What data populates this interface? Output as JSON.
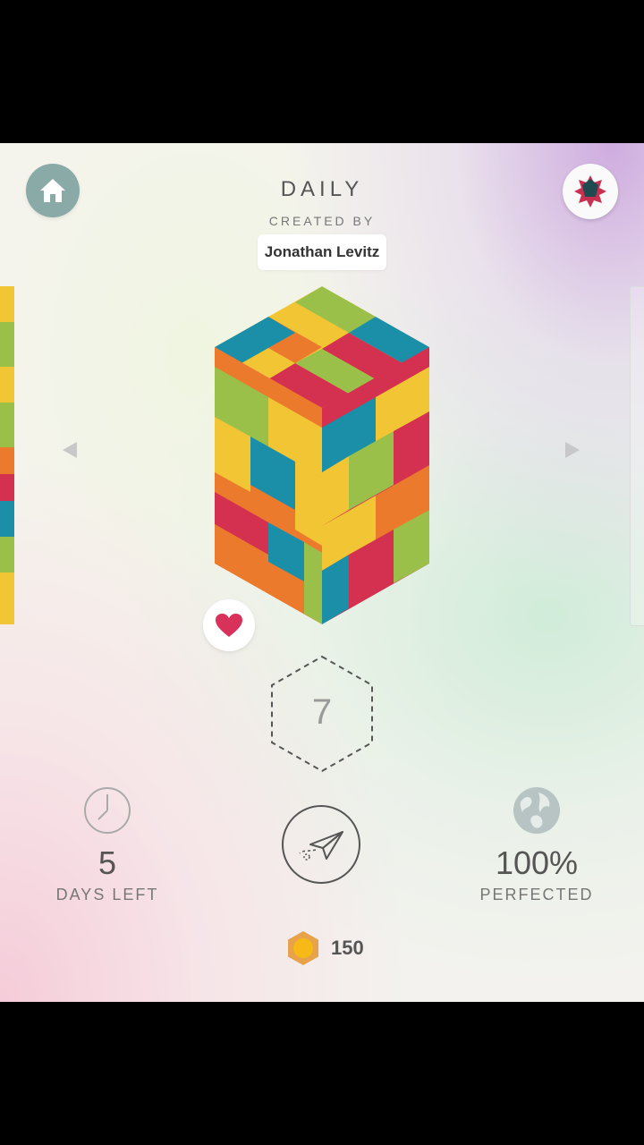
{
  "header": {
    "mode_title": "DAILY",
    "created_by_label": "CREATED BY",
    "author": "Jonathan Levitz"
  },
  "icons": {
    "home": "home-icon",
    "badge": "star-badge-icon",
    "favorite": "heart-icon",
    "clock": "clock-icon",
    "world": "globe-icon",
    "send": "paper-plane-icon",
    "coin": "hex-coin-icon",
    "prev": "left-arrow-icon",
    "next": "right-arrow-icon"
  },
  "puzzle": {
    "piece_count": "7"
  },
  "stats": {
    "days_left_value": "5",
    "days_left_label": "DAYS LEFT",
    "perfected_value": "100%",
    "perfected_label": "PERFECTED"
  },
  "wallet": {
    "coins": "150"
  },
  "colors": {
    "home_button": "#8aaaa8",
    "heart": "#d9325a",
    "coin_outer": "#e7a24a",
    "coin_inner": "#f7b917",
    "piece_red": "#d4304f",
    "piece_yellow": "#f2c535",
    "piece_green": "#9bc04a",
    "piece_blue": "#1b8fa8",
    "piece_orange": "#ec7a2d"
  }
}
